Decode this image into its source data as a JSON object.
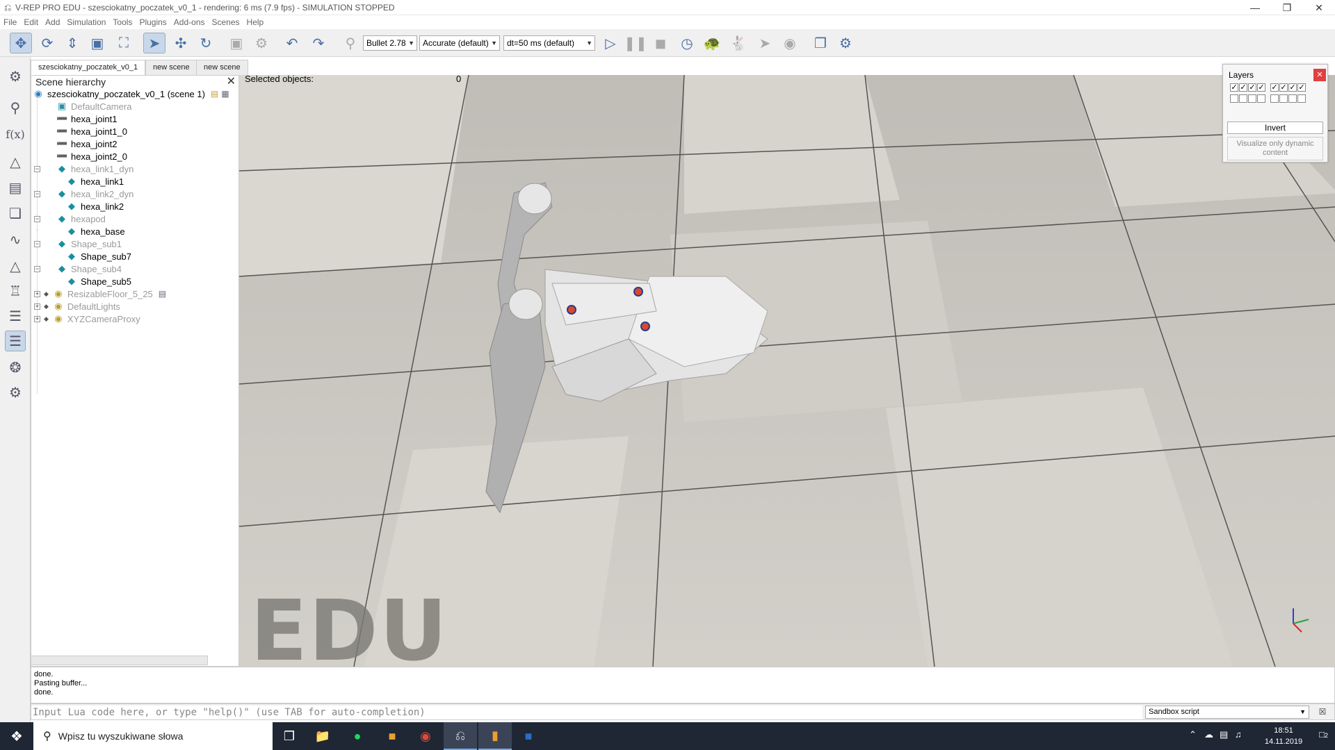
{
  "window": {
    "title": "V-REP PRO EDU - szesciokatny_poczatek_v0_1 - rendering: 6 ms (7.9 fps) - SIMULATION STOPPED",
    "app_icon": "vrep-icon",
    "controls": [
      "minimize",
      "restore",
      "close"
    ]
  },
  "menu": {
    "items": [
      "File",
      "Edit",
      "Add",
      "Simulation",
      "Tools",
      "Plugins",
      "Add-ons",
      "Scenes",
      "Help"
    ]
  },
  "toolbar": {
    "engine": "Bullet 2.78",
    "accuracy": "Accurate (default)",
    "timestep": "dt=50 ms (default)",
    "buttons": [
      "camera-pan-icon",
      "camera-rotate-icon",
      "camera-shift-icon",
      "camera-angle-icon",
      "fit-to-view-icon",
      "click-select-icon",
      "object-shift-icon",
      "object-rotate-icon",
      "assemble-icon",
      "transfer-dna-icon",
      "undo-icon",
      "redo-icon",
      "dynamics-icon",
      "start-simulation-icon",
      "pause-simulation-icon",
      "stop-simulation-icon",
      "real-time-icon",
      "slow-down-icon",
      "speed-up-icon",
      "thread-rendering-icon",
      "toggle-visualization-icon",
      "page-selector-icon",
      "scene-selector-icon"
    ]
  },
  "left_toolbar": [
    "simulation-settings-icon",
    "zoom-icon",
    "script-icon",
    "object-properties-icon",
    "calculation-modules-icon",
    "collections-icon",
    "path-icon",
    "selection-icon",
    "model-browser-icon",
    "scene-hierarchy-icon",
    "layers-icon",
    "video-recorder-icon",
    "user-settings-icon"
  ],
  "scene_tabs": [
    "szesciokatny_poczatek_v0_1",
    "new scene",
    "new scene"
  ],
  "hierarchy": {
    "header": "Scene hierarchy",
    "root": "szesciokatny_poczatek_v0_1 (scene 1)",
    "items": [
      {
        "label": "DefaultCamera",
        "icon": "camera-icon",
        "greyed": true
      },
      {
        "label": "hexa_joint1",
        "icon": "joint-icon",
        "greyed": false
      },
      {
        "label": "hexa_joint1_0",
        "icon": "joint-icon",
        "greyed": false
      },
      {
        "label": "hexa_joint2",
        "icon": "joint-icon",
        "greyed": false
      },
      {
        "label": "hexa_joint2_0",
        "icon": "joint-icon",
        "greyed": false
      },
      {
        "label": "hexa_link1_dyn",
        "icon": "shape-icon",
        "greyed": true
      },
      {
        "label": "hexa_link1",
        "icon": "shape-icon",
        "greyed": false
      },
      {
        "label": "hexa_link2_dyn",
        "icon": "shape-icon",
        "greyed": true
      },
      {
        "label": "hexa_link2",
        "icon": "shape-icon",
        "greyed": false
      },
      {
        "label": "hexapod",
        "icon": "shape-icon",
        "greyed": true
      },
      {
        "label": "hexa_base",
        "icon": "shape-icon",
        "greyed": false
      },
      {
        "label": "Shape_sub1",
        "icon": "shape-icon",
        "greyed": true
      },
      {
        "label": "Shape_sub7",
        "icon": "shape-icon",
        "greyed": false
      },
      {
        "label": "Shape_sub4",
        "icon": "shape-icon",
        "greyed": true
      },
      {
        "label": "Shape_sub5",
        "icon": "shape-icon",
        "greyed": false
      },
      {
        "label": "ResizableFloor_5_25",
        "icon": "model-icon",
        "greyed": true
      },
      {
        "label": "DefaultLights",
        "icon": "model-icon",
        "greyed": true
      },
      {
        "label": "XYZCameraProxy",
        "icon": "model-icon",
        "greyed": true
      }
    ]
  },
  "viewport": {
    "selected_label": "Selected objects:",
    "selected_count": "0",
    "watermark": "EDU",
    "floor_color": "#cbcac4"
  },
  "layers": {
    "title": "Layers",
    "row1_checked": [
      true,
      true,
      true,
      true,
      true,
      true,
      true,
      true
    ],
    "row2_checked": [
      false,
      false,
      false,
      false,
      false,
      false,
      false,
      false
    ],
    "invert_label": "Invert",
    "visualize_label": "Visualize only dynamic content"
  },
  "console": {
    "lines": [
      "done.",
      "Pasting buffer...",
      "done."
    ]
  },
  "lua": {
    "placeholder": "Input Lua code here, or type \"help()\" (use TAB for auto-completion)",
    "script_selector": "Sandbox script"
  },
  "taskbar": {
    "search_placeholder": "Wpisz tu wyszukiwane słowa",
    "apps": [
      "task-view-icon",
      "file-explorer-icon",
      "spotify-icon",
      "blender-icon",
      "chrome-icon",
      "vrep-icon",
      "inventor-icon",
      "word-icon"
    ],
    "time": "18:51",
    "date": "14.11.2019",
    "notifications": "2"
  },
  "colors": {
    "accent": "#4a6fa5",
    "taskbar": "#1f2634",
    "layers_close": "#e04040"
  }
}
